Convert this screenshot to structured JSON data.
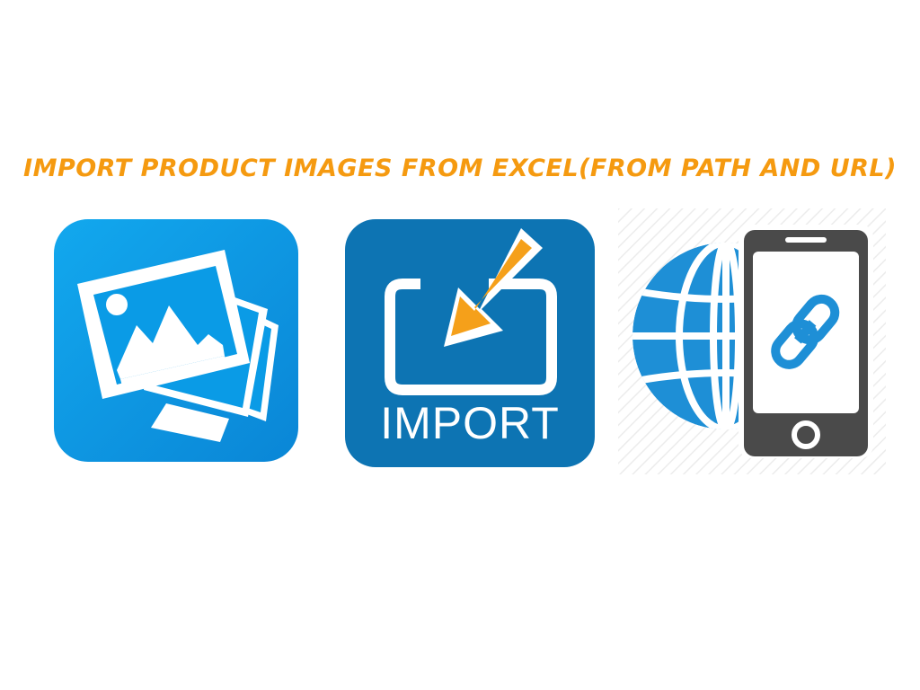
{
  "headline": "IMPORT PRODUCT IMAGES FROM EXCEL(FROM PATH AND URL)",
  "colors": {
    "headline": "#f59a10",
    "photos_bg": "#0a9be6",
    "import_bg": "#0d74b3",
    "arrow": "#f5a01a",
    "globe": "#1e8fd6",
    "phone": "#4a4a4a",
    "link": "#1e8fd6"
  },
  "icons": {
    "photos": "photo-stack-icon",
    "import": "import-arrow-icon",
    "url": "globe-phone-link-icon"
  },
  "import_tile": {
    "label": "IMPORT"
  }
}
